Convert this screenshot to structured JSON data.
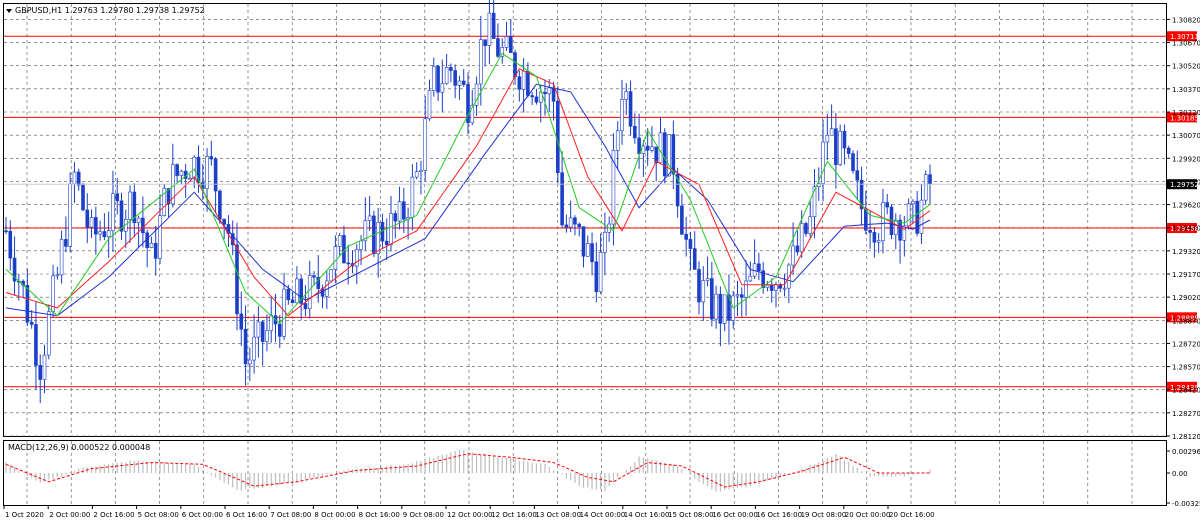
{
  "window": {
    "symbol_info": "GBPUSD,H1  1.29763 1.29780 1.29738 1.29752",
    "menu_icon": "triangle-down-icon"
  },
  "main_chart": {
    "price_ticks": [
      "1.30820",
      "1.30670",
      "1.30520",
      "1.30370",
      "1.30220",
      "1.30070",
      "1.29920",
      "1.29770",
      "1.29620",
      "1.29470",
      "1.29320",
      "1.29170",
      "1.29020",
      "1.28870",
      "1.28720",
      "1.28570",
      "1.28420",
      "1.28270",
      "1.28120"
    ],
    "levels": [
      {
        "label": "1.30711",
        "value": 1.30711
      },
      {
        "label": "1.30185",
        "value": 1.30185
      },
      {
        "label": "1.29468",
        "value": 1.29468
      },
      {
        "label": "1.28889",
        "value": 1.28889
      },
      {
        "label": "1.28439",
        "value": 1.28439
      }
    ],
    "current_price": {
      "label": "1.29752",
      "value": 1.29752
    },
    "colors": {
      "candles": "#1b3fc7",
      "level": "#ff0000",
      "ma_fast": "#22cc22",
      "ma_mid": "#ff2020",
      "ma_slow": "#2030d0",
      "grid": "#505050",
      "current_bg": "#000000"
    }
  },
  "macd": {
    "label": "MACD(12,26,9) 0.000522 0.000048",
    "ticks": [
      "0.002963",
      "0.00",
      "-0.003251"
    ],
    "colors": {
      "histogram": "#bdbdbd",
      "signal": "#ff0000"
    }
  },
  "time_axis": {
    "labels": [
      "1 Oct 2020",
      "2 Oct 00:00",
      "2 Oct 16:00",
      "5 Oct 08:00",
      "6 Oct 00:00",
      "6 Oct 16:00",
      "7 Oct 08:00",
      "8 Oct 00:00",
      "8 Oct 16:00",
      "9 Oct 08:00",
      "12 Oct 00:00",
      "12 Oct 16:00",
      "13 Oct 08:00",
      "14 Oct 00:00",
      "14 Oct 16:00",
      "15 Oct 08:00",
      "16 Oct 00:00",
      "16 Oct 16:00",
      "19 Oct 08:00",
      "20 Oct 00:00",
      "20 Oct 16:00"
    ]
  },
  "chart_data": {
    "type": "candlestick",
    "symbol": "GBPUSD",
    "timeframe": "H1",
    "ylim": [
      1.2812,
      1.3092
    ],
    "close_path": [
      [
        0,
        1.2945
      ],
      [
        4,
        1.2905
      ],
      [
        8,
        1.286
      ],
      [
        12,
        1.2915
      ],
      [
        16,
        1.298
      ],
      [
        20,
        1.294
      ],
      [
        25,
        1.2955
      ],
      [
        30,
        1.2965
      ],
      [
        34,
        1.2925
      ],
      [
        38,
        1.2975
      ],
      [
        43,
        1.299
      ],
      [
        48,
        1.2985
      ],
      [
        52,
        1.2945
      ],
      [
        56,
        1.286
      ],
      [
        60,
        1.2875
      ],
      [
        64,
        1.289
      ],
      [
        68,
        1.29
      ],
      [
        72,
        1.2905
      ],
      [
        76,
        1.2925
      ],
      [
        80,
        1.2935
      ],
      [
        84,
        1.294
      ],
      [
        88,
        1.2945
      ],
      [
        92,
        1.295
      ],
      [
        96,
        1.298
      ],
      [
        100,
        1.304
      ],
      [
        104,
        1.305
      ],
      [
        108,
        1.303
      ],
      [
        112,
        1.3075
      ],
      [
        116,
        1.306
      ],
      [
        120,
        1.305
      ],
      [
        124,
        1.304
      ],
      [
        128,
        1.303
      ],
      [
        130,
        1.295
      ],
      [
        134,
        1.294
      ],
      [
        138,
        1.292
      ],
      [
        140,
        1.293
      ],
      [
        144,
        1.304
      ],
      [
        148,
        1.301
      ],
      [
        152,
        1.3
      ],
      [
        156,
        1.299
      ],
      [
        160,
        1.292
      ],
      [
        164,
        1.29
      ],
      [
        168,
        1.289
      ],
      [
        172,
        1.29
      ],
      [
        176,
        1.292
      ],
      [
        180,
        1.2915
      ],
      [
        184,
        1.2925
      ],
      [
        188,
        1.295
      ],
      [
        192,
        1.301
      ],
      [
        196,
        1.299
      ],
      [
        200,
        1.296
      ],
      [
        204,
        1.295
      ],
      [
        208,
        1.2955
      ],
      [
        212,
        1.295
      ],
      [
        216,
        1.2975
      ]
    ],
    "ma_fast": [
      [
        0,
        1.292
      ],
      [
        12,
        1.289
      ],
      [
        24,
        1.294
      ],
      [
        44,
        1.2985
      ],
      [
        56,
        1.2905
      ],
      [
        64,
        1.2885
      ],
      [
        80,
        1.2935
      ],
      [
        96,
        1.2955
      ],
      [
        108,
        1.302
      ],
      [
        116,
        1.306
      ],
      [
        124,
        1.3045
      ],
      [
        134,
        1.296
      ],
      [
        142,
        1.2945
      ],
      [
        150,
        1.301
      ],
      [
        160,
        1.2965
      ],
      [
        170,
        1.2895
      ],
      [
        180,
        1.2915
      ],
      [
        192,
        1.299
      ],
      [
        202,
        1.2955
      ],
      [
        210,
        1.295
      ],
      [
        216,
        1.2962
      ]
    ],
    "ma_mid": [
      [
        0,
        1.2905
      ],
      [
        12,
        1.2895
      ],
      [
        24,
        1.2925
      ],
      [
        44,
        1.298
      ],
      [
        58,
        1.2915
      ],
      [
        66,
        1.289
      ],
      [
        82,
        1.2925
      ],
      [
        96,
        1.2945
      ],
      [
        110,
        1.3
      ],
      [
        120,
        1.305
      ],
      [
        128,
        1.304
      ],
      [
        136,
        1.298
      ],
      [
        144,
        1.2945
      ],
      [
        152,
        1.299
      ],
      [
        162,
        1.2975
      ],
      [
        172,
        1.291
      ],
      [
        182,
        1.291
      ],
      [
        194,
        1.297
      ],
      [
        204,
        1.2955
      ],
      [
        210,
        1.2946
      ],
      [
        216,
        1.2958
      ]
    ],
    "ma_slow": [
      [
        0,
        1.2895
      ],
      [
        12,
        1.289
      ],
      [
        24,
        1.2915
      ],
      [
        44,
        1.297
      ],
      [
        60,
        1.292
      ],
      [
        70,
        1.29
      ],
      [
        84,
        1.292
      ],
      [
        98,
        1.294
      ],
      [
        112,
        1.2995
      ],
      [
        124,
        1.304
      ],
      [
        132,
        1.3035
      ],
      [
        140,
        1.3
      ],
      [
        148,
        1.296
      ],
      [
        156,
        1.2985
      ],
      [
        164,
        1.2965
      ],
      [
        174,
        1.292
      ],
      [
        184,
        1.2912
      ],
      [
        196,
        1.2948
      ],
      [
        206,
        1.295
      ],
      [
        212,
        1.2946
      ],
      [
        216,
        1.2952
      ]
    ],
    "macd_signal": [
      [
        0,
        0.001
      ],
      [
        10,
        -0.001
      ],
      [
        20,
        0.0005
      ],
      [
        34,
        0.0012
      ],
      [
        46,
        0.001
      ],
      [
        58,
        -0.0015
      ],
      [
        68,
        -0.001
      ],
      [
        82,
        0.0003
      ],
      [
        96,
        0.0008
      ],
      [
        108,
        0.0022
      ],
      [
        118,
        0.0018
      ],
      [
        128,
        0.0012
      ],
      [
        136,
        -0.0005
      ],
      [
        142,
        -0.001
      ],
      [
        150,
        0.0012
      ],
      [
        158,
        0.0008
      ],
      [
        168,
        -0.0016
      ],
      [
        176,
        -0.001
      ],
      [
        186,
        0.0002
      ],
      [
        196,
        0.0018
      ],
      [
        204,
        0.0
      ],
      [
        216,
        0.0
      ]
    ],
    "macd_hist": [
      [
        0,
        0.0012
      ],
      [
        8,
        -0.0012
      ],
      [
        18,
        0.0006
      ],
      [
        30,
        0.0014
      ],
      [
        44,
        0.001
      ],
      [
        54,
        -0.002
      ],
      [
        66,
        -0.0012
      ],
      [
        80,
        0.0004
      ],
      [
        94,
        0.001
      ],
      [
        106,
        0.0026
      ],
      [
        116,
        0.0018
      ],
      [
        126,
        0.001
      ],
      [
        134,
        -0.0015
      ],
      [
        140,
        -0.002
      ],
      [
        148,
        0.0018
      ],
      [
        156,
        0.001
      ],
      [
        166,
        -0.0022
      ],
      [
        174,
        -0.0015
      ],
      [
        186,
        0.0004
      ],
      [
        194,
        0.0022
      ],
      [
        202,
        -0.0004
      ],
      [
        210,
        -0.0004
      ],
      [
        216,
        0.0003
      ]
    ]
  }
}
